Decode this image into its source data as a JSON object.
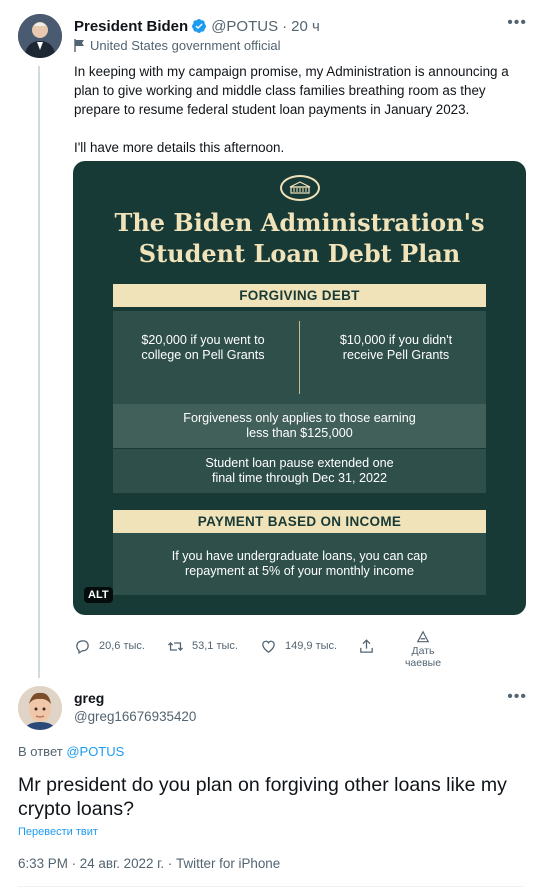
{
  "tweet": {
    "author_name": "President Biden",
    "handle": "@POTUS",
    "separator": "·",
    "time": "20 ч",
    "label": "United States government official",
    "text_paragraphs": [
      "In keeping with my campaign promise, my Administration is announcing a plan to give working and middle class families breathing room as they prepare to resume federal student loan payments in January 2023.",
      "I'll have more details this afternoon."
    ],
    "image": {
      "title": "The Biden Administration's Student Loan Debt Plan",
      "section1_header": "FORGIVING DEBT",
      "left_box": "$20,000 if you went to college on Pell Grants",
      "right_box": "$10,000 if you didn't receive Pell Grants",
      "box3": "Forgiveness only applies to those earning less than $125,000",
      "box4": "Student loan pause extended one final time through Dec 31, 2022",
      "section2_header": "PAYMENT BASED ON INCOME",
      "box5": "If you have undergraduate loans, you can cap repayment at 5% of your monthly income",
      "alt_badge": "ALT"
    },
    "actions": {
      "replies": "20,6 тыс.",
      "retweets": "53,1 тыс.",
      "likes": "149,9 тыс.",
      "tip_label": "Дать чаевые"
    }
  },
  "reply": {
    "author_name": "greg",
    "handle": "@greg16676935420",
    "reply_prefix": "В ответ",
    "reply_to": "@POTUS",
    "text": "Mr president do you plan on forgiving other loans like my crypto loans?",
    "translate": "Перевести твит",
    "meta": "6:33 PM · 24 авг. 2022 г. · Twitter for iPhone"
  },
  "colors": {
    "accent": "#1d9bf0",
    "card_bg": "#183a37",
    "card_gold": "#f1e3b9",
    "muted_text": "#536471"
  }
}
